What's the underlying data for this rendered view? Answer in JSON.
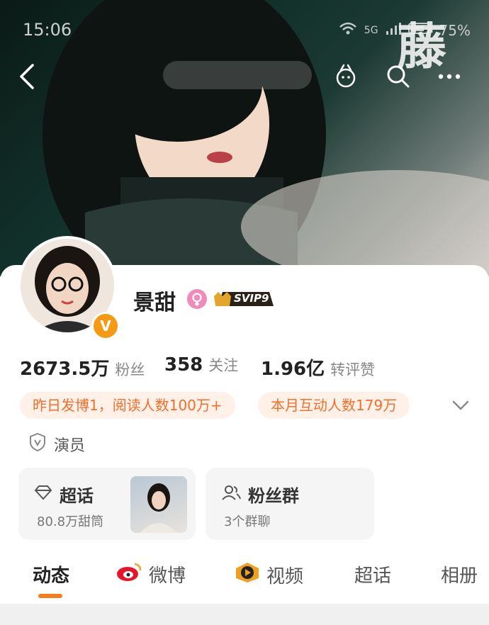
{
  "status_bar": {
    "time": "15:06",
    "network": "5G",
    "battery": "75%"
  },
  "banner_watermark": "藤",
  "profile": {
    "name": "景甜",
    "vip_badge": "SVIP9",
    "verified_mark": "V",
    "role": "演员"
  },
  "stats": [
    {
      "value": "2673.5万",
      "label": "粉丝"
    },
    {
      "value": "358",
      "label": "关注"
    },
    {
      "value": "1.96亿",
      "label": "转评赞"
    }
  ],
  "tags": [
    "昨日发博1，阅读人数100万+",
    "本月互动人数179万"
  ],
  "cards": {
    "supertopic": {
      "title": "超话",
      "subtitle": "80.8万甜筒"
    },
    "fan_group": {
      "title": "粉丝群",
      "subtitle": "3个群聊"
    }
  },
  "tabs": [
    {
      "label": "动态",
      "icon": ""
    },
    {
      "label": "微博",
      "icon": "weibo-icon"
    },
    {
      "label": "视频",
      "icon": "video-icon"
    },
    {
      "label": "超话",
      "icon": ""
    },
    {
      "label": "相册",
      "icon": ""
    }
  ],
  "colors": {
    "accent": "#f57d20",
    "tag_text": "#f16e2c",
    "tag_bg": "#fff1e8",
    "verified": "#f59a14"
  }
}
